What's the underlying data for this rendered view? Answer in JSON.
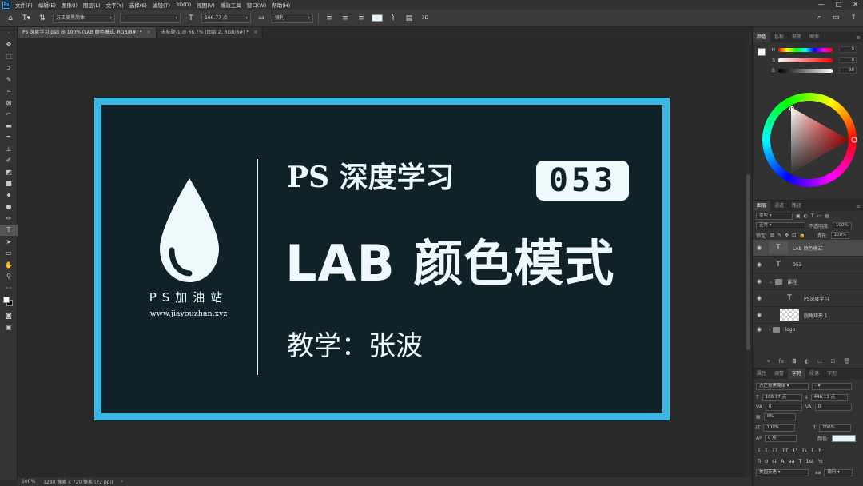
{
  "menubar": {
    "logo": "Ps",
    "items": [
      "文件(F)",
      "编辑(E)",
      "图像(I)",
      "图层(L)",
      "文字(Y)",
      "选择(S)",
      "滤镜(T)",
      "3D(D)",
      "视图(V)",
      "增效工具",
      "窗口(W)",
      "帮助(H)"
    ],
    "minimize": "—",
    "maximize": "□",
    "close": "✕"
  },
  "options": {
    "font_family": "方正美黑简体",
    "font_style": "-",
    "font_size": "166.77 点",
    "antialias": "锐利",
    "mode_3d": "3D"
  },
  "tabs": [
    {
      "label": "PS 深度学习.psd @ 100% (LAB 颜色模式, RGB/8#) *",
      "active": true
    },
    {
      "label": "未标题-1 @ 66.7% (图层 2, RGB/8#) *",
      "active": false
    }
  ],
  "document": {
    "brand": "PS加油站",
    "url": "www.jiayouzhan.xyz",
    "title1": "PS 深度学习",
    "badge": "053",
    "title2": "LAB 颜色模式",
    "teacher": "教学：张波",
    "frame_color": "#3ab8e3",
    "background_color": "#0e2227"
  },
  "status": {
    "zoom": "100%",
    "size": "1280 像素 x 720 像素 (72 ppi)"
  },
  "color_panel": {
    "tabs": [
      "颜色",
      "色板",
      "渐变",
      "图案"
    ],
    "rows": [
      {
        "label": "H",
        "value": "0"
      },
      {
        "label": "S",
        "value": "0"
      },
      {
        "label": "B",
        "value": "98"
      }
    ]
  },
  "layers_panel": {
    "tabs": [
      "图层",
      "通道",
      "路径"
    ],
    "filter": "类型",
    "blend_mode": "正常",
    "opacity_label": "不透明度:",
    "opacity": "100%",
    "lock_label": "锁定:",
    "fill_label": "填充:",
    "fill": "100%",
    "layers": [
      {
        "name": "LAB 颜色模式",
        "kind": "T",
        "selected": true
      },
      {
        "name": "053",
        "kind": "T",
        "selected": false
      },
      {
        "name": "课程",
        "kind": "folder",
        "selected": false
      },
      {
        "name": "PS深度学习",
        "kind": "T",
        "selected": false
      },
      {
        "name": "圆角矩形 1",
        "kind": "shape",
        "selected": false
      },
      {
        "name": "logo",
        "kind": "folder",
        "selected": false
      }
    ]
  },
  "char_panel": {
    "tabs": [
      "属性",
      "调整",
      "字符",
      "段落",
      "字形"
    ],
    "font_family": "方正美黑简体",
    "font_style": "-",
    "font_size": "166.77 点",
    "leading": "446.11 点",
    "kerning": "0",
    "tracking": "0",
    "scale_pct": "0%",
    "vscale": "100%",
    "hscale": "100%",
    "baseline": "0 点",
    "color_label": "颜色:",
    "language": "美国英语",
    "aa": "锐利"
  }
}
